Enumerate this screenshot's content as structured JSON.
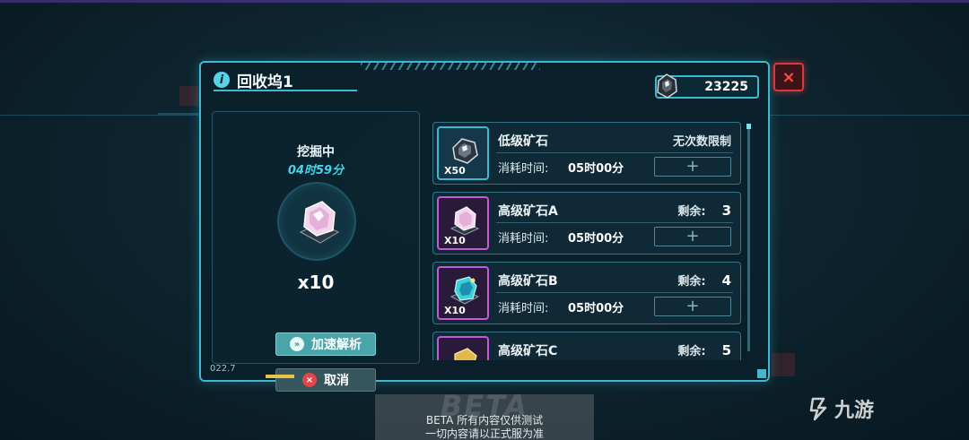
{
  "window": {
    "title": "回收坞1",
    "currency_value": "23225",
    "close_symbol": "×",
    "info_symbol": "i"
  },
  "mining": {
    "status": "挖掘中",
    "time_left": "04时59分",
    "quantity": "x10",
    "speed_button": "加速解析",
    "cancel_button": "取消",
    "speed_icon_symbol": "»",
    "cancel_icon_symbol": "×"
  },
  "items": [
    {
      "name": "低级矿石",
      "right_label": "无次数限制",
      "remaining": "",
      "qty": "X50",
      "time_label": "消耗时间:",
      "time": "05时00分",
      "icon": "dark-ore-icon",
      "frame": "blue"
    },
    {
      "name": "高级矿石A",
      "right_label": "剩余:",
      "remaining": "3",
      "qty": "X10",
      "time_label": "消耗时间:",
      "time": "05时00分",
      "icon": "pink-crystal-icon",
      "frame": "purple"
    },
    {
      "name": "高级矿石B",
      "right_label": "剩余:",
      "remaining": "4",
      "qty": "X10",
      "time_label": "消耗时间:",
      "time": "05时00分",
      "icon": "cyan-crystal-icon",
      "frame": "purple"
    },
    {
      "name": "高级矿石C",
      "right_label": "剩余:",
      "remaining": "5",
      "qty": "",
      "time_label": "",
      "time": "",
      "icon": "gold-crystal-icon",
      "frame": "purple"
    }
  ],
  "plus_symbol": "+",
  "version_label": "022.7",
  "beta": {
    "watermark": "BETA",
    "line1": "BETA 所有内容仅供测试",
    "line2": "一切内容请以正式服为准"
  },
  "site_watermark": "九游",
  "colors": {
    "accent": "#3fb8d0",
    "close": "#d63a3a",
    "time_highlight": "#45d4e8",
    "purple_frame": "#c45ad8",
    "speed_button": "#4aa5aa"
  }
}
